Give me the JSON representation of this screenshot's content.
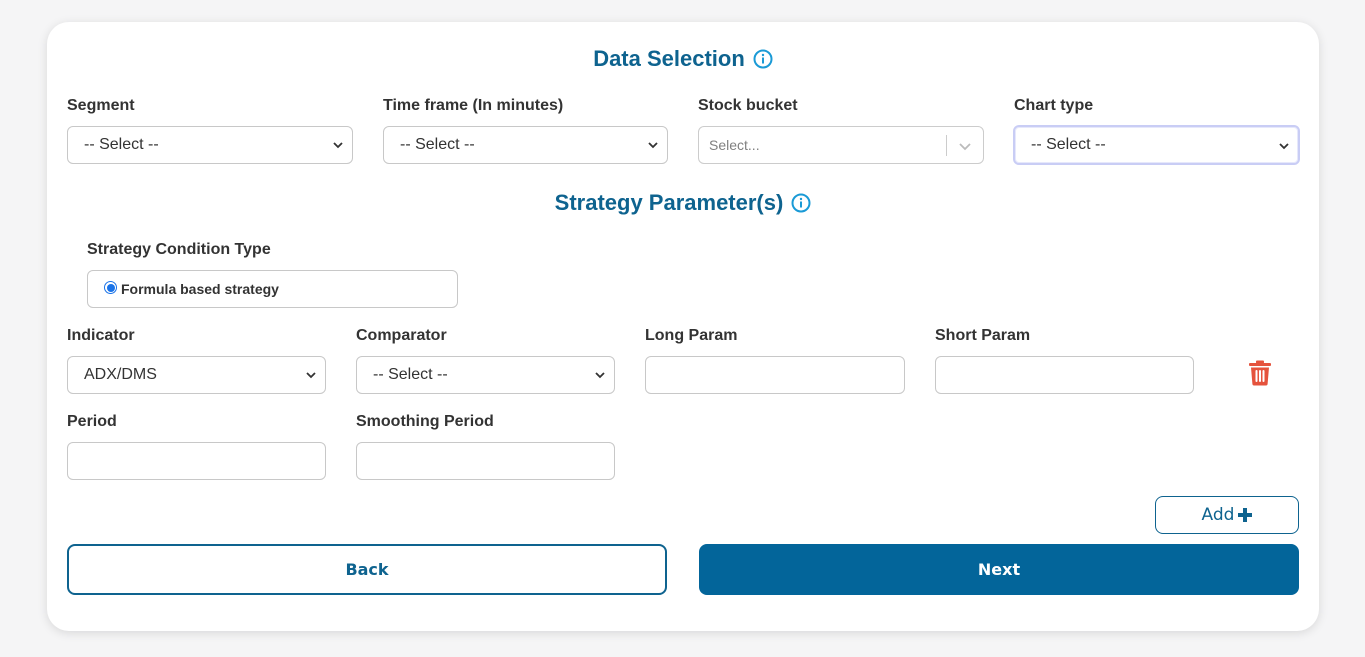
{
  "data_selection": {
    "title": "Data Selection",
    "info_icon": "info-circle-icon",
    "fields": {
      "segment": {
        "label": "Segment",
        "value": "-- Select --"
      },
      "time_frame": {
        "label": "Time frame (In minutes)",
        "value": "-- Select --"
      },
      "stock_bucket": {
        "label": "Stock bucket",
        "placeholder": "Select..."
      },
      "chart_type": {
        "label": "Chart type",
        "value": "-- Select --"
      }
    }
  },
  "strategy_parameters": {
    "title": "Strategy Parameter(s)",
    "info_icon": "info-circle-icon",
    "condition_type": {
      "label": "Strategy Condition Type",
      "option_label": "Formula based strategy",
      "selected": true
    },
    "row": {
      "indicator": {
        "label": "Indicator",
        "value": "ADX/DMS"
      },
      "comparator": {
        "label": "Comparator",
        "value": "-- Select --"
      },
      "long_param": {
        "label": "Long Param",
        "value": ""
      },
      "short_param": {
        "label": "Short Param",
        "value": ""
      },
      "period": {
        "label": "Period",
        "value": ""
      },
      "smoothing_period": {
        "label": "Smoothing Period",
        "value": ""
      }
    },
    "delete_icon": "trash-icon",
    "add_button": {
      "label": "Add",
      "icon": "plus-icon"
    }
  },
  "nav": {
    "back_label": "Back",
    "next_label": "Next"
  },
  "colors": {
    "primary": "#03659a",
    "title": "#0e638f",
    "info": "#1a9ad6",
    "danger": "#e5533d"
  }
}
